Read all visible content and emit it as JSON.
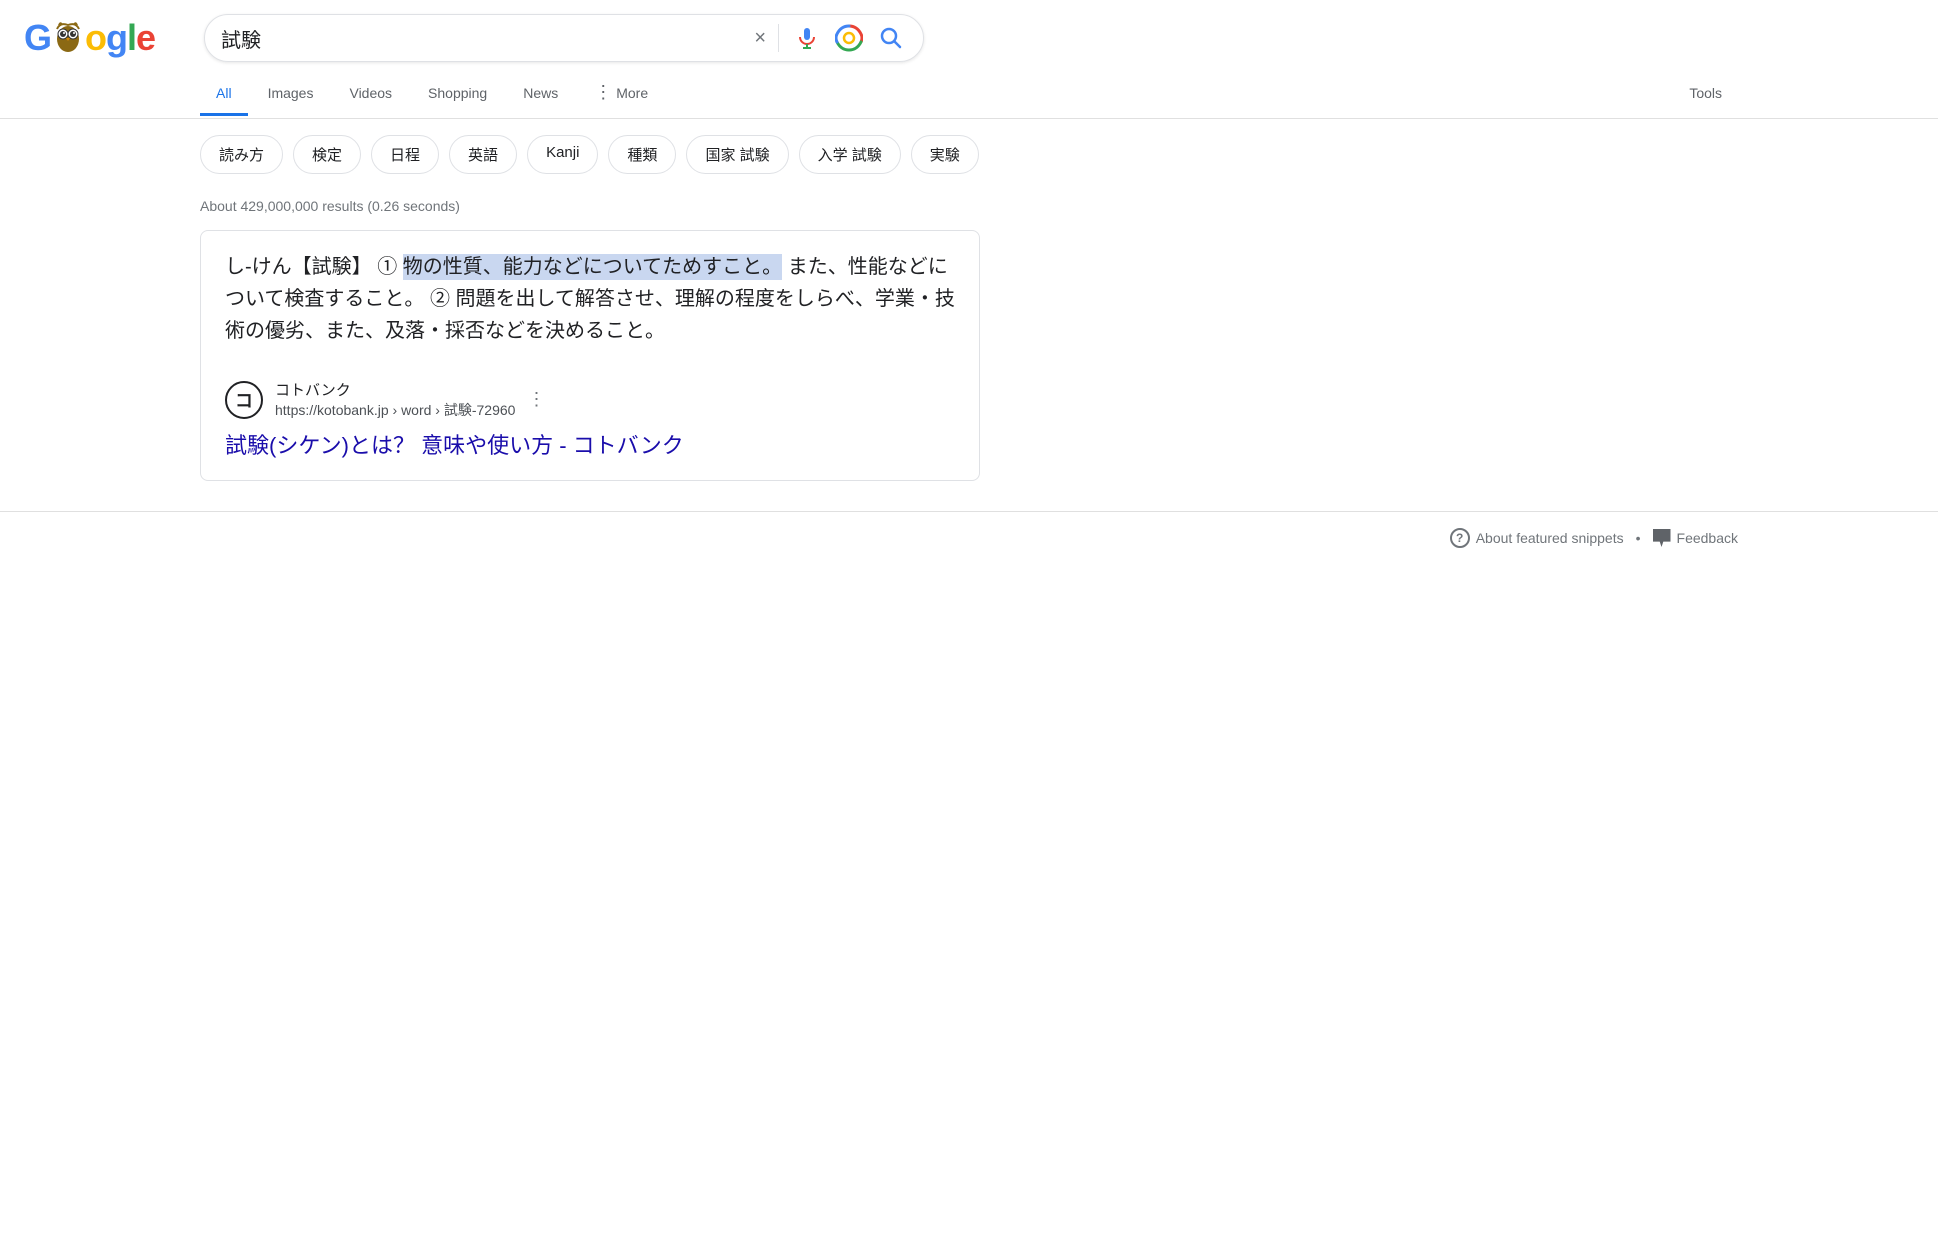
{
  "header": {
    "logo_text": "Google",
    "search_query": "試験",
    "clear_label": "×",
    "voice_label": "voice search",
    "lens_label": "search by image",
    "search_submit_label": "search"
  },
  "nav": {
    "tabs": [
      {
        "id": "all",
        "label": "All",
        "active": true
      },
      {
        "id": "images",
        "label": "Images",
        "active": false
      },
      {
        "id": "videos",
        "label": "Videos",
        "active": false
      },
      {
        "id": "shopping",
        "label": "Shopping",
        "active": false
      },
      {
        "id": "news",
        "label": "News",
        "active": false
      },
      {
        "id": "more",
        "label": "More",
        "active": false
      }
    ],
    "tools_label": "Tools"
  },
  "chips": {
    "items": [
      "読み方",
      "検定",
      "日程",
      "英語",
      "Kanji",
      "種類",
      "国家 試験",
      "入学 試験",
      "実験"
    ]
  },
  "results": {
    "count_text": "About 429,000,000 results (0.26 seconds)",
    "featured_snippet": {
      "text_before_highlight": "し‐けん【試験】 ① ",
      "text_highlight": "物の性質、能力などについてためすこと。",
      "text_after": " また、性能などについて検査すること。 ② 問題を出して解答させ、理解の程度をしらべ、学業・技術の優劣、また、及落・採否などを決めること。"
    },
    "source": {
      "icon_text": "コ",
      "name": "コトバンク",
      "url": "https://kotobank.jp › word › 試験-72960"
    },
    "result_link_text": "試験(シケン)とは？ 意味や使い方 - コトバンク"
  },
  "bottom_bar": {
    "about_snippets_label": "About featured snippets",
    "separator": "•",
    "feedback_label": "Feedback"
  }
}
